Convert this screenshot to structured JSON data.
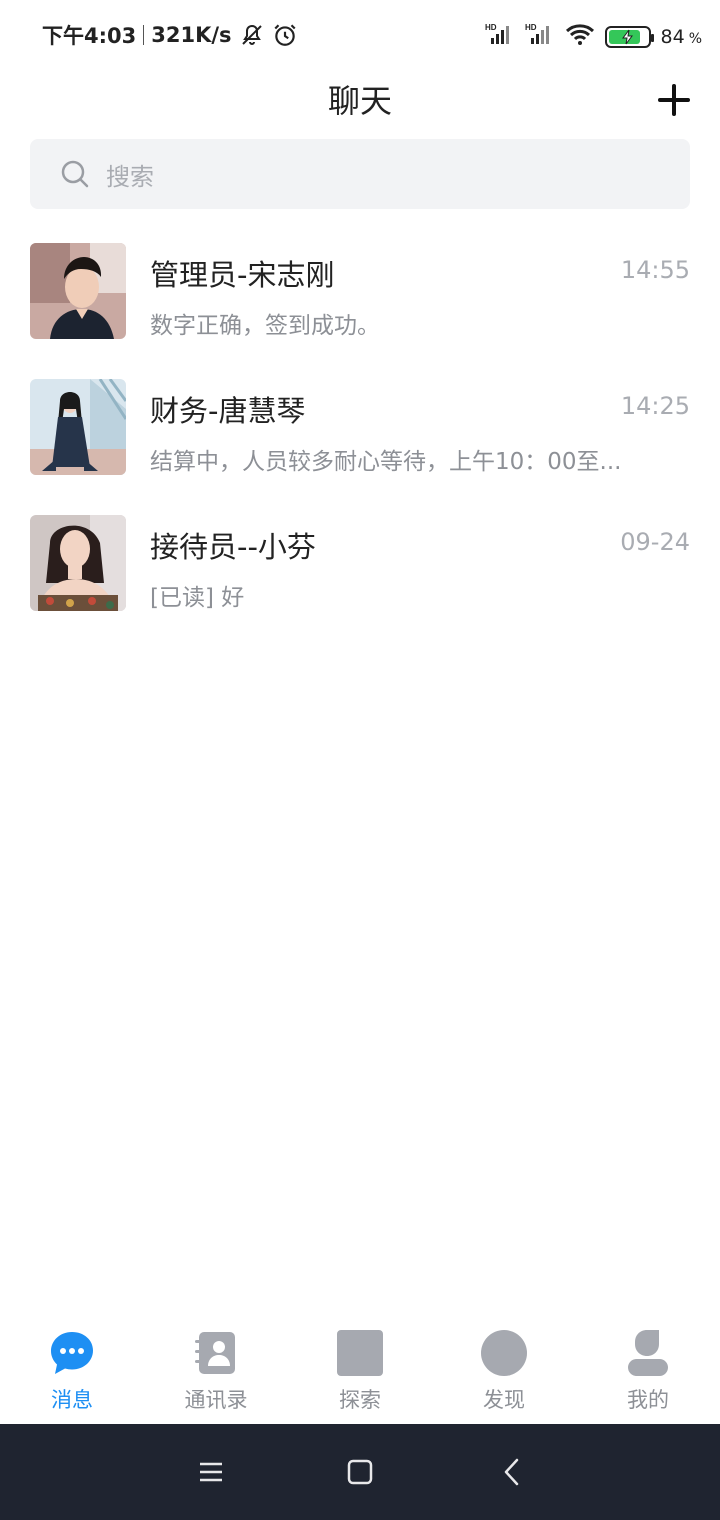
{
  "status_bar": {
    "time": "下午4:03",
    "speed": "321K/s",
    "battery_level": "84",
    "battery_pct_sign": "%",
    "battery_fill_fraction": 0.84,
    "icons": [
      "mute-icon",
      "alarm-icon",
      "hd-signal-icon",
      "hd-signal-icon",
      "wifi-icon",
      "battery-charging-icon"
    ]
  },
  "header": {
    "title": "聊天",
    "add_icon": "plus-icon"
  },
  "search": {
    "placeholder": "搜索",
    "icon": "search-icon"
  },
  "chats": [
    {
      "name": "管理员-宋志刚",
      "time": "14:55",
      "preview": "数字正确，签到成功。"
    },
    {
      "name": "财务-唐慧琴",
      "time": "14:25",
      "preview": "结算中，人员较多耐心等待，上午10：00至..."
    },
    {
      "name": "接待员--小芬",
      "time": "09-24",
      "preview": "[已读] 好"
    }
  ],
  "tabs": [
    {
      "label": "消息",
      "icon": "chat-bubble-icon",
      "active": true
    },
    {
      "label": "通讯录",
      "icon": "contacts-icon",
      "active": false
    },
    {
      "label": "探索",
      "icon": "explore-icon",
      "active": false
    },
    {
      "label": "发现",
      "icon": "discover-icon",
      "active": false
    },
    {
      "label": "我的",
      "icon": "profile-icon",
      "active": false
    }
  ],
  "colors": {
    "accent": "#1e8ff3",
    "inactive_icon": "#a6a9b0",
    "nav_bar": "#1f2430"
  }
}
